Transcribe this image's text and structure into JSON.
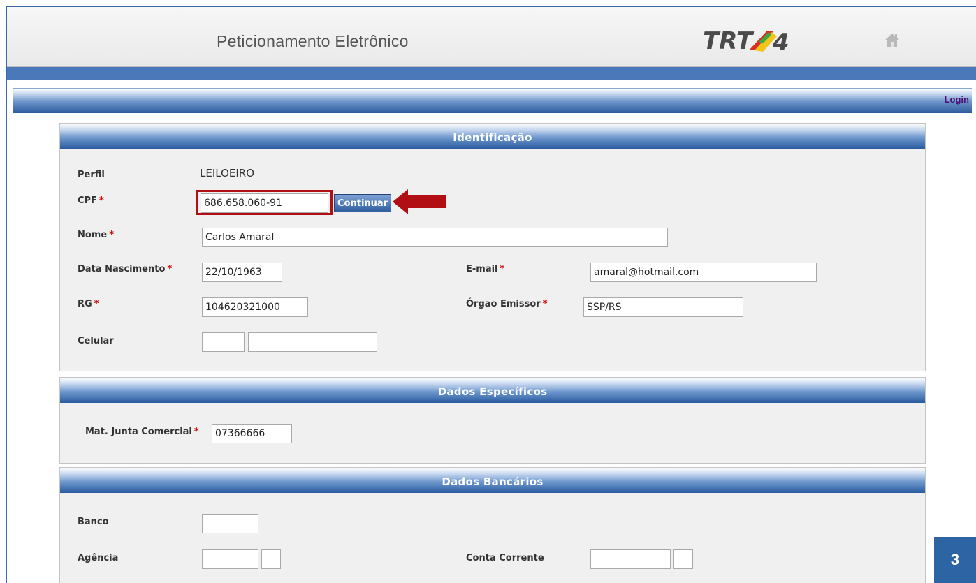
{
  "header": {
    "title": "Peticionamento Eletrônico",
    "logo_text": "TRT",
    "logo_number": "4"
  },
  "nav": {
    "login_label": "Login"
  },
  "identificacao": {
    "title": "Identificação",
    "perfil_label": "Perfil",
    "perfil_value": "LEILOEIRO",
    "cpf_label": "CPF",
    "cpf_value": "686.658.060-91",
    "continuar_label": "Continuar",
    "nome_label": "Nome",
    "nome_value": "Carlos Amaral",
    "nascimento_label": "Data Nascimento",
    "nascimento_value": "22/10/1963",
    "email_label": "E-mail",
    "email_value": "amaral@hotmail.com",
    "rg_label": "RG",
    "rg_value": "104620321000",
    "orgao_label": "Órgão Emissor",
    "orgao_value": "SSP/RS",
    "celular_label": "Celular",
    "celular_ddd": "",
    "celular_numero": ""
  },
  "dados_especificos": {
    "title": "Dados Específicos",
    "junta_label": "Mat. Junta Comercial",
    "junta_value": "07366666"
  },
  "dados_bancarios": {
    "title": "Dados Bancários",
    "banco_label": "Banco",
    "banco_value": "",
    "agencia_label": "Agência",
    "agencia_value": "",
    "agencia_dv": "",
    "conta_label": "Conta Corrente",
    "conta_value": "",
    "conta_dv": ""
  },
  "required_mark": "*",
  "page_number": "3",
  "colors": {
    "header_blue": "#2c5a9d",
    "required_red": "#cc0000",
    "highlight_red": "#b20f14",
    "login_purple": "#4b0f74"
  }
}
